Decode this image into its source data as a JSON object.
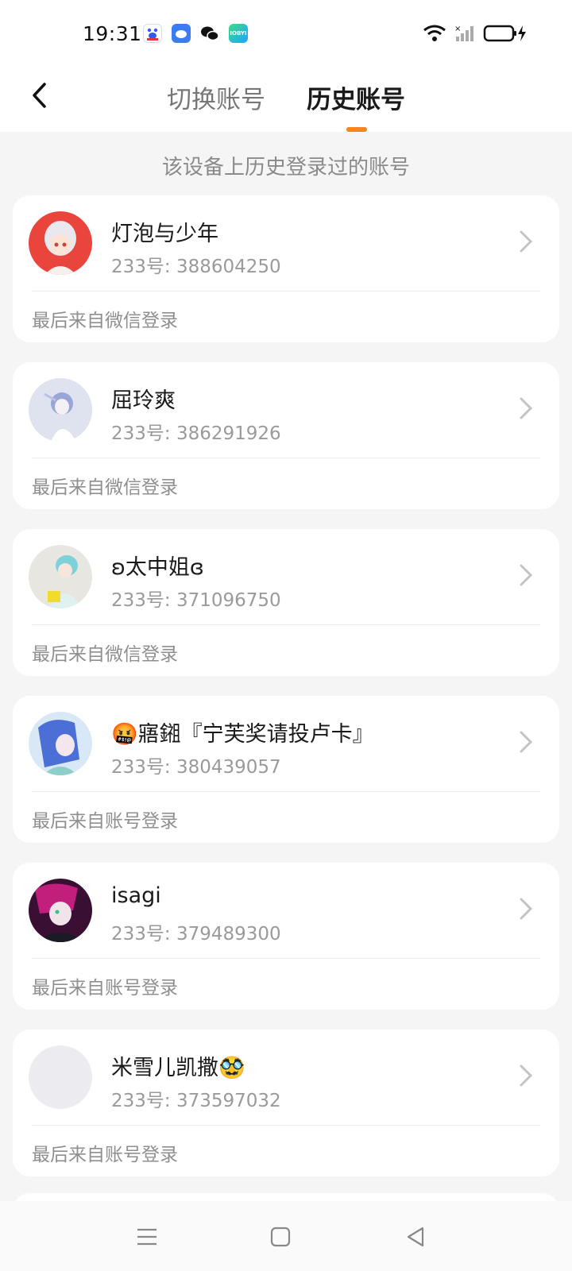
{
  "status_bar": {
    "time": "19:31",
    "app_icons": [
      "baidu-icon",
      "cloud-icon",
      "wechat-icon",
      "joy-icon"
    ],
    "battery_color": "#111111"
  },
  "header": {
    "tabs": [
      {
        "label": "切换账号",
        "active": false
      },
      {
        "label": "历史账号",
        "active": true
      }
    ],
    "accent_color": "#f6841f"
  },
  "subtitle": "该设备上历史登录过的账号",
  "accounts": [
    {
      "name": "灯泡与少年",
      "id": "233号: 388604250",
      "login_source": "最后来自微信登录",
      "avatar_color": "#e9453d"
    },
    {
      "name": "屈玲爽",
      "id": "233号: 386291926",
      "login_source": "最后来自微信登录",
      "avatar_color": "#c9d3ec"
    },
    {
      "name": "ʚ太中姐ɞ",
      "id": "233号: 371096750",
      "login_source": "最后来自微信登录",
      "avatar_color": "#e8e6e0"
    },
    {
      "name": "🤬寤鎺『宁芙奖请投卢卡』",
      "id": "233号: 380439057",
      "login_source": "最后来自账号登录",
      "avatar_color": "#cfe3f5"
    },
    {
      "name": "isagi",
      "id": "233号: 379489300",
      "login_source": "最后来自账号登录",
      "avatar_color": "#5a1b4a"
    },
    {
      "name": "米雪儿凯撒🥸",
      "id": "233号: 373597032",
      "login_source": "最后来自账号登录",
      "avatar_color": "#ececf0"
    }
  ]
}
